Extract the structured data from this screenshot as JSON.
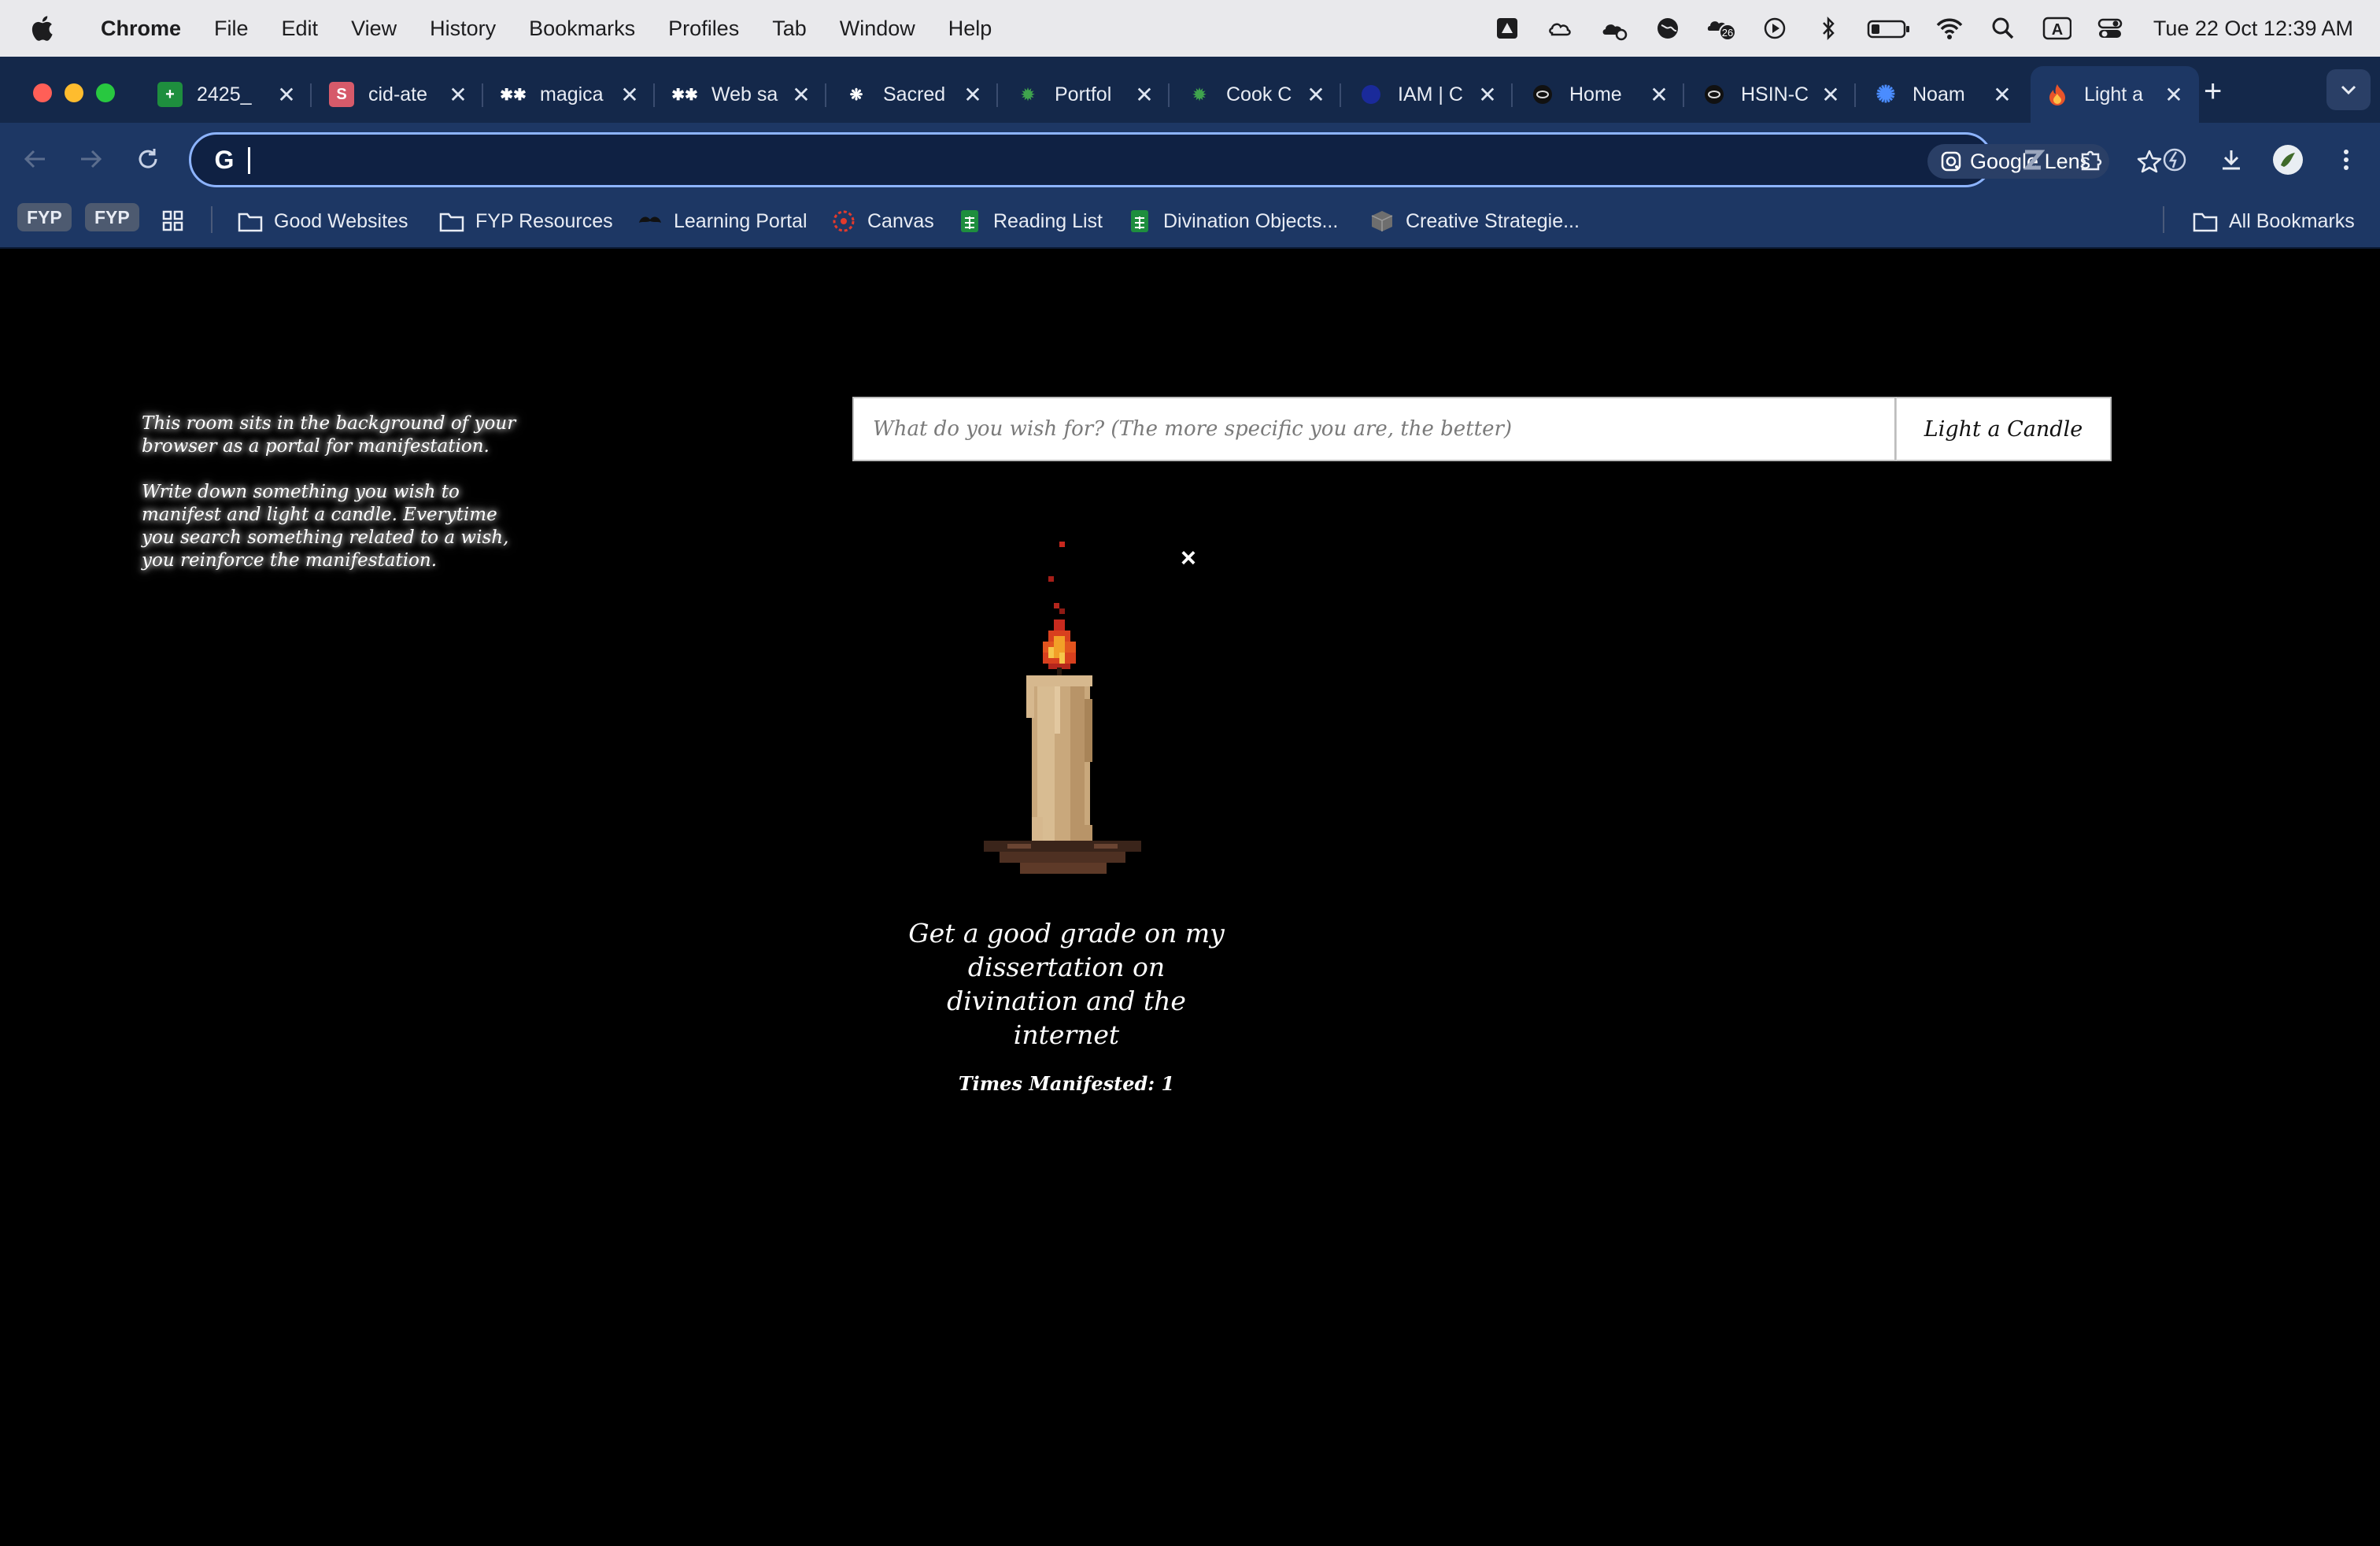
{
  "menubar": {
    "app_name": "Chrome",
    "items": [
      "File",
      "Edit",
      "View",
      "History",
      "Bookmarks",
      "Profiles",
      "Tab",
      "Window",
      "Help"
    ],
    "status_icons": [
      "vpn-icon",
      "creative-cloud-icon",
      "cloud-sync-icon",
      "globe-icon",
      "notification-count-icon",
      "play-icon",
      "bluetooth-icon",
      "battery-icon",
      "wifi-icon",
      "spotlight-icon",
      "input-source-icon",
      "control-center-icon"
    ],
    "notification_count": "26",
    "input_source": "A",
    "clock": "Tue 22 Oct  12:39 AM"
  },
  "tabs": [
    {
      "title": "2425_",
      "icon": "sheets-icon",
      "color": "#1e8e3e"
    },
    {
      "title": "cid-ate",
      "icon": "s-icon",
      "color": "#d65a6a"
    },
    {
      "title": "magica",
      "icon": "asterisk-icon",
      "color": "#ffffff"
    },
    {
      "title": "Web sa",
      "icon": "asterisk-icon",
      "color": "#ffffff"
    },
    {
      "title": "Sacred",
      "icon": "openai-icon",
      "color": "#ffffff"
    },
    {
      "title": "Portfol",
      "icon": "gear-logo-icon",
      "color": "#3fa34d"
    },
    {
      "title": "Cook C",
      "icon": "gear-logo-icon",
      "color": "#3fa34d"
    },
    {
      "title": "IAM | C",
      "icon": "circle-icon",
      "color": "#1a2a9a"
    },
    {
      "title": "Home",
      "icon": "ring-icon",
      "color": "#111111"
    },
    {
      "title": "HSIN-C",
      "icon": "ring-icon",
      "color": "#111111"
    },
    {
      "title": "Noam",
      "icon": "burst-icon",
      "color": "#4a8cff"
    },
    {
      "title": "Light a",
      "icon": "flame-icon",
      "color": "#e8542a",
      "active": true
    }
  ],
  "toolbar": {
    "omnibox_value": "",
    "lens_label": "Google Lens"
  },
  "bookmarks": {
    "profile_pills": [
      "FYP",
      "FYP"
    ],
    "items": [
      {
        "label": "Good Websites",
        "icon": "folder-icon"
      },
      {
        "label": "FYP Resources",
        "icon": "folder-icon"
      },
      {
        "label": "Learning Portal",
        "icon": "mustache-icon"
      },
      {
        "label": "Canvas",
        "icon": "canvas-icon"
      },
      {
        "label": "Reading List",
        "icon": "sheets-icon"
      },
      {
        "label": "Divination Objects...",
        "icon": "sheets-icon"
      },
      {
        "label": "Creative Strategie...",
        "icon": "cube-icon"
      }
    ],
    "all_bookmarks": "All Bookmarks"
  },
  "page": {
    "intro_p1": "This room sits in the background of your browser as a portal for manifestation.",
    "intro_p2": "Write down something you wish to manifest and light a candle. Everytime you search something related to a wish, you reinforce the manifestation.",
    "wish_placeholder": "What do you wish for? (The more specific you are, the better)",
    "wish_value": "",
    "button_label": "Light a Candle",
    "close_symbol": "×",
    "candle": {
      "wish": "Get a good grade on my dissertation on divination and the internet",
      "counter_text": "Times Manifested: 1"
    }
  }
}
